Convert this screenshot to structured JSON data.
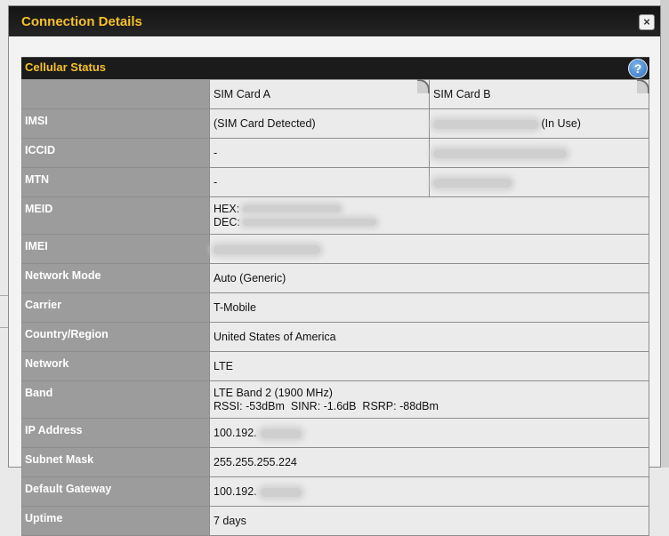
{
  "dialog": {
    "title": "Connection Details",
    "close_label": "×"
  },
  "section": {
    "title": "Cellular Status",
    "help_label": "?"
  },
  "table": {
    "header": {
      "label": "",
      "sim_a": "SIM Card A",
      "sim_b": "SIM Card B"
    },
    "imsi": {
      "label": "IMSI",
      "sim_a": "(SIM Card Detected)",
      "sim_b_suffix": "(In Use)"
    },
    "iccid": {
      "label": "ICCID",
      "sim_a": "-"
    },
    "mtn": {
      "label": "MTN",
      "sim_a": "-"
    },
    "meid": {
      "label": "MEID",
      "hex_label": "HEX:",
      "dec_label": "DEC:"
    },
    "imei": {
      "label": "IMEI"
    },
    "network_mode": {
      "label": "Network Mode",
      "value": "Auto (Generic)"
    },
    "carrier": {
      "label": "Carrier",
      "value": "T-Mobile"
    },
    "country": {
      "label": "Country/Region",
      "value": "United States of America"
    },
    "network": {
      "label": "Network",
      "value": "LTE"
    },
    "band": {
      "label": "Band",
      "value": "LTE Band 2 (1900 MHz)",
      "signal": "RSSI: -53dBm  SINR: -1.6dB  RSRP: -88dBm"
    },
    "ip": {
      "label": "IP Address",
      "value": "100.192."
    },
    "subnet": {
      "label": "Subnet Mask",
      "value": "255.255.255.224"
    },
    "gateway": {
      "label": "Default Gateway",
      "value": "100.192."
    },
    "uptime": {
      "label": "Uptime",
      "value": "7 days"
    }
  }
}
